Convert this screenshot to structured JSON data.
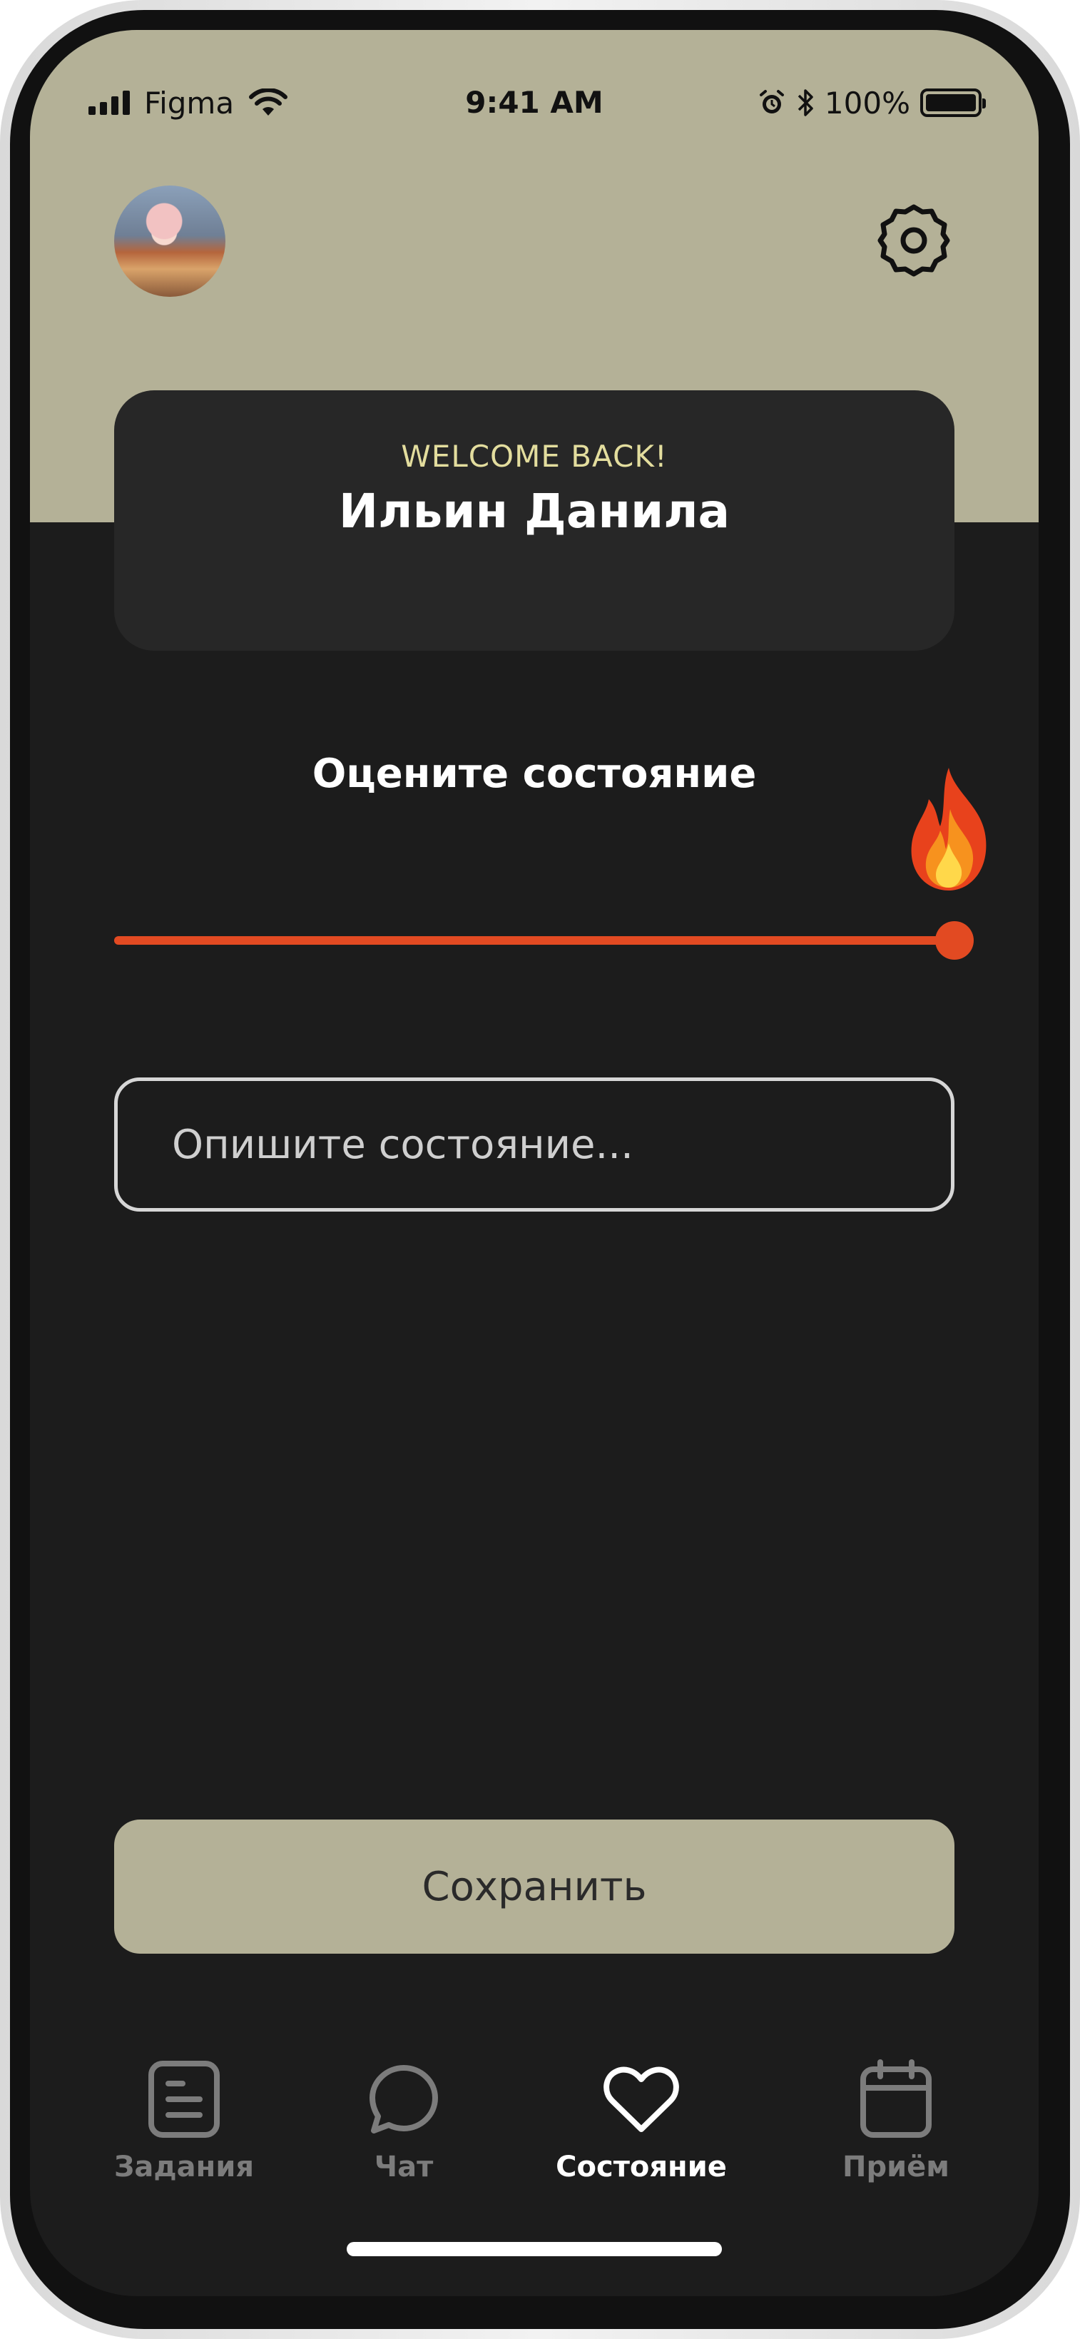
{
  "status_bar": {
    "carrier": "Figma",
    "time": "9:41 AM",
    "battery_percent": "100%"
  },
  "header": {
    "welcome_label": "WELCOME BACK!",
    "user_name": "Ильин Данила",
    "avatar_icon": "user-avatar-photo",
    "settings_icon": "gear-icon"
  },
  "rating": {
    "title": "Оцените состояние",
    "emoji_icon": "fire-emoji-icon",
    "slider_level": 1.0,
    "accent_color": "#e24a22"
  },
  "describe": {
    "placeholder": "Опишите состояние..."
  },
  "actions": {
    "save_label": "Сохранить"
  },
  "tabs": [
    {
      "label": "Задания",
      "icon": "tasks-list-icon",
      "active": false
    },
    {
      "label": "Чат",
      "icon": "chat-bubble-icon",
      "active": false
    },
    {
      "label": "Состояние",
      "icon": "heart-icon",
      "active": true
    },
    {
      "label": "Приём",
      "icon": "calendar-icon",
      "active": false
    }
  ],
  "colors": {
    "header_bg": "#b4b197",
    "screen_bg": "#1c1c1c",
    "card_bg": "#272727",
    "welcome_text": "#e3dd9e",
    "inactive_tab": "#7c7c7c"
  }
}
